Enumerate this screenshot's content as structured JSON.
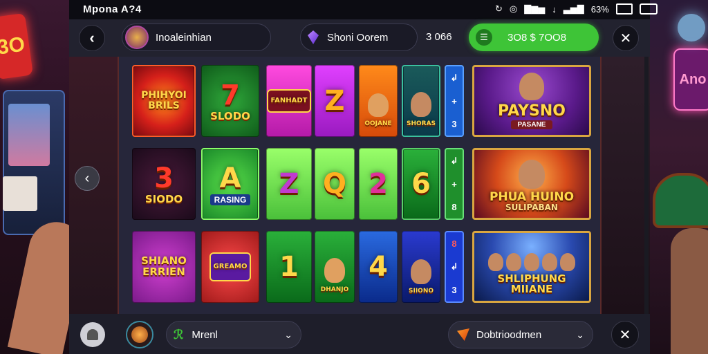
{
  "status_bar": {
    "title": "Mpona A?4",
    "battery": "",
    "signal_text": "63%"
  },
  "top_bar": {
    "profile_name": "Inoaleinhian",
    "search_label": "Shoni Oorem",
    "balance_value": "3 066",
    "deposit_label": "3O8 $ 7OO8"
  },
  "grid": {
    "row1": {
      "tile1": "PHIHYOI BRILS",
      "tile2_digit": "7",
      "tile2_label": "SLODO",
      "tile3_label": "FANHADT",
      "tile4_digit": "Z",
      "tile5_label": "OOJANE",
      "tile6_label": "SHORAS",
      "strip": [
        "↲",
        "+",
        "3"
      ]
    },
    "row2": {
      "tile1_digit": "3",
      "tile1_label": "SIODO",
      "tile2_digit": "A",
      "tile2_label": "RASING",
      "tile3_digit": "Z",
      "tile4_digit": "Q",
      "tile5_digit": "2",
      "tile6_digit": "6",
      "strip": [
        "↲",
        "+",
        "8"
      ]
    },
    "row3": {
      "tile1": "SHIANO ERRIEN",
      "tile2_label": "GREAMO",
      "tile3_digit": "1",
      "tile4_label": "DHANJO",
      "tile5_digit": "4",
      "tile6_label": "SIIONO",
      "strip": [
        "8",
        "↲",
        "3"
      ]
    }
  },
  "promos": {
    "promo1_title": "PAYSNO",
    "promo1_sub": "PASANE",
    "promo2_title": "PHUA HUINO",
    "promo2_sub": "SULIPABAN",
    "promo3_title": "SHLIPHUNG MIIANE"
  },
  "bottom_bar": {
    "menu_label": "Mrenl",
    "dropdown_label": "Dobtrioodmen"
  },
  "background_signs": {
    "left_sign": "3O",
    "right_sign": "Ano"
  },
  "colors": {
    "deposit_green": "#3ec437",
    "promo_gold": "#d9a640",
    "strip_blue": "#1a5fd1",
    "strip_green": "#1f8f2c"
  }
}
